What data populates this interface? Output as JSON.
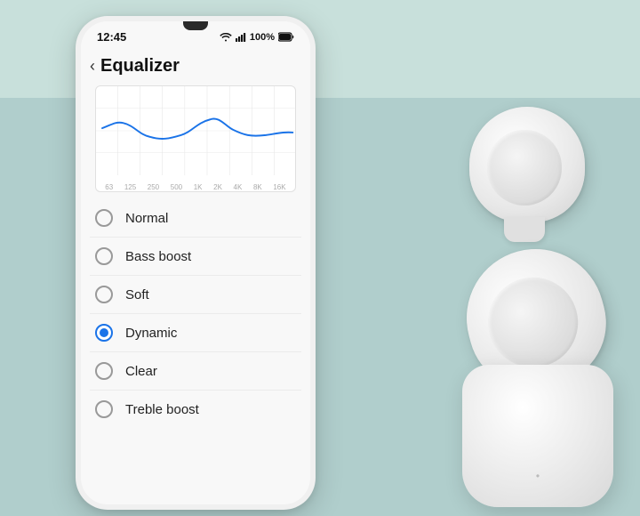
{
  "background": {
    "top_color": "#c8e0db",
    "bottom_color": "#b0cecc"
  },
  "status_bar": {
    "time": "12:45",
    "battery": "100%",
    "signal": "wifi+bars"
  },
  "header": {
    "back_label": "‹",
    "title": "Equalizer"
  },
  "eq_graph": {
    "labels": [
      "63",
      "125",
      "250",
      "500",
      "1K",
      "2K",
      "4K",
      "8K",
      "16K"
    ]
  },
  "options": [
    {
      "id": "normal",
      "label": "Normal",
      "selected": false
    },
    {
      "id": "bass-boost",
      "label": "Bass boost",
      "selected": false
    },
    {
      "id": "soft",
      "label": "Soft",
      "selected": false
    },
    {
      "id": "dynamic",
      "label": "Dynamic",
      "selected": true
    },
    {
      "id": "clear",
      "label": "Clear",
      "selected": false
    },
    {
      "id": "treble-boost",
      "label": "Treble boost",
      "selected": false
    }
  ]
}
